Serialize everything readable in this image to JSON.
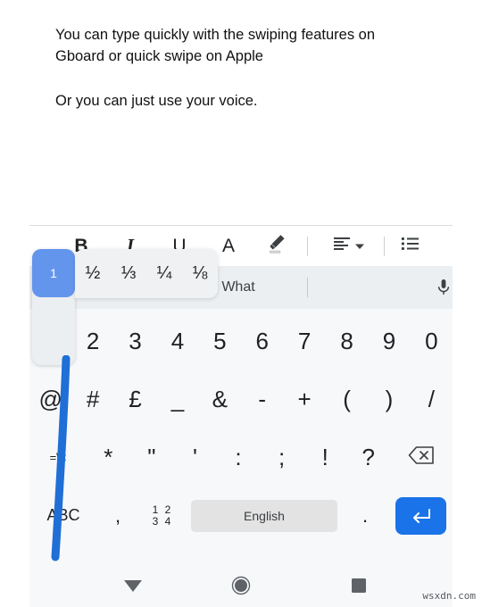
{
  "document": {
    "paragraphs": [
      "You can type quickly with the swiping features on\nGboard or quick swipe on Apple",
      "Or you can just use your voice."
    ]
  },
  "toolbar": {
    "items": [
      {
        "name": "bold",
        "label": "B"
      },
      {
        "name": "italic",
        "label": "I"
      },
      {
        "name": "underline",
        "label": "U"
      },
      {
        "name": "text-color",
        "label": "A"
      },
      {
        "name": "highlighter",
        "label": ""
      },
      {
        "name": "align",
        "label": ""
      },
      {
        "name": "bulleted-list",
        "label": ""
      }
    ]
  },
  "key_preview": {
    "label": "1"
  },
  "fraction_popup": {
    "options": [
      "½",
      "⅓",
      "¼",
      "⅛"
    ]
  },
  "keyboard": {
    "suggestions": [
      {
        "label": ""
      },
      {
        "label": "What"
      },
      {
        "label": ""
      }
    ],
    "mic_icon": "microphone-icon",
    "rows": [
      {
        "name": "number-row",
        "keys": [
          {
            "name": "key-1",
            "label": "1"
          },
          {
            "name": "key-2",
            "label": "2"
          },
          {
            "name": "key-3",
            "label": "3"
          },
          {
            "name": "key-4",
            "label": "4"
          },
          {
            "name": "key-5",
            "label": "5"
          },
          {
            "name": "key-6",
            "label": "6"
          },
          {
            "name": "key-7",
            "label": "7"
          },
          {
            "name": "key-8",
            "label": "8"
          },
          {
            "name": "key-9",
            "label": "9"
          },
          {
            "name": "key-0",
            "label": "0"
          }
        ]
      },
      {
        "name": "symbol-row-1",
        "keys": [
          {
            "name": "key-at",
            "label": "@"
          },
          {
            "name": "key-hash",
            "label": "#"
          },
          {
            "name": "key-pound",
            "label": "£"
          },
          {
            "name": "key-underscore",
            "label": "_"
          },
          {
            "name": "key-ampersand",
            "label": "&"
          },
          {
            "name": "key-hyphen",
            "label": "-"
          },
          {
            "name": "key-plus",
            "label": "+"
          },
          {
            "name": "key-paren-open",
            "label": "("
          },
          {
            "name": "key-paren-close",
            "label": ")"
          },
          {
            "name": "key-slash",
            "label": "/"
          }
        ]
      },
      {
        "name": "symbol-row-2",
        "keys": [
          {
            "name": "key-more-symbols",
            "label": "=\\<"
          },
          {
            "name": "key-asterisk",
            "label": "*"
          },
          {
            "name": "key-double-quote",
            "label": "\""
          },
          {
            "name": "key-single-quote",
            "label": "'"
          },
          {
            "name": "key-colon",
            "label": ":"
          },
          {
            "name": "key-semicolon",
            "label": ";"
          },
          {
            "name": "key-exclamation",
            "label": "!"
          },
          {
            "name": "key-question",
            "label": "?"
          },
          {
            "name": "key-backspace",
            "label": ""
          }
        ]
      }
    ],
    "bottom_row": {
      "abc": "ABC",
      "comma": ",",
      "numpad_top": "1 2",
      "numpad_bottom": "3 4",
      "space": "English",
      "period": ".",
      "enter_icon": "enter-arrow-icon"
    }
  },
  "navbar": {
    "back": "back-triangle-icon",
    "home": "home-circle-icon",
    "recents": "recents-square-icon"
  },
  "watermark": "wsxdn.com",
  "colors": {
    "accent_blue": "#1a73e8",
    "preview_blue": "#6495ed",
    "swipe_blue": "#1f6fd6",
    "keyboard_bg": "#f7f8fa",
    "suggestion_bg": "#eceff1",
    "spacebar_gray": "#e3e3e3"
  }
}
